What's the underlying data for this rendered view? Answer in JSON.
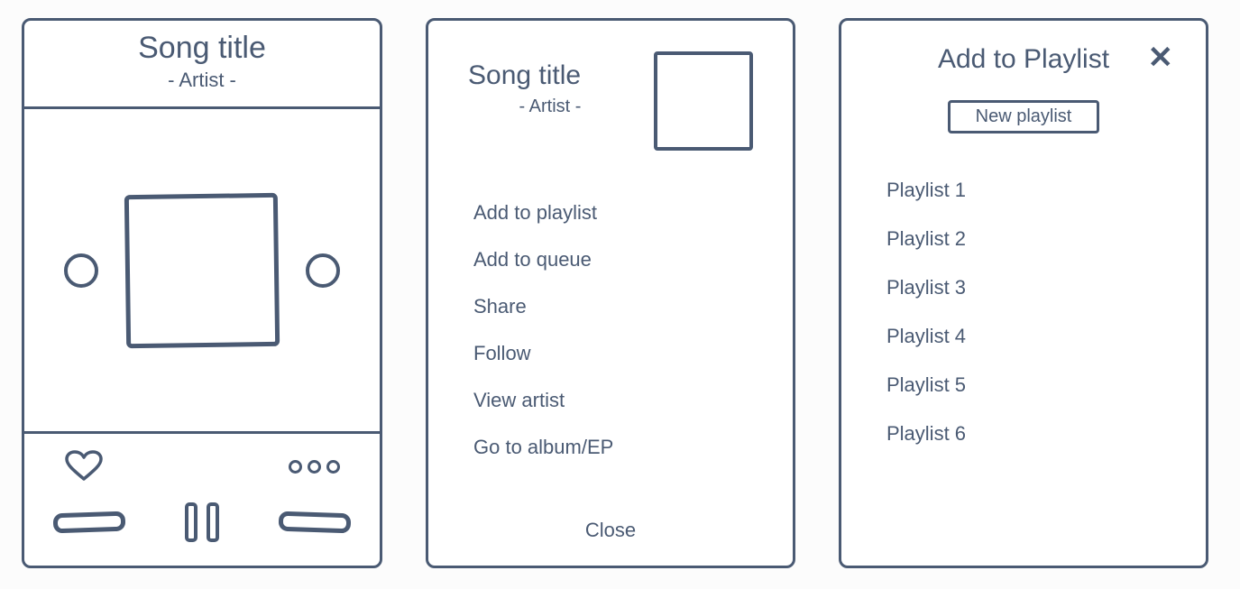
{
  "player": {
    "title": "Song title",
    "artist": "- Artist -"
  },
  "songMenu": {
    "title": "Song title",
    "artist": "- Artist -",
    "items": [
      "Add to playlist",
      "Add to queue",
      "Share",
      "Follow",
      "View artist",
      "Go to album/EP"
    ],
    "close": "Close"
  },
  "addPlaylist": {
    "title": "Add to Playlist",
    "newButton": "New playlist",
    "playlists": [
      "Playlist 1",
      "Playlist 2",
      "Playlist 3",
      "Playlist 4",
      "Playlist 5",
      "Playlist 6"
    ]
  }
}
